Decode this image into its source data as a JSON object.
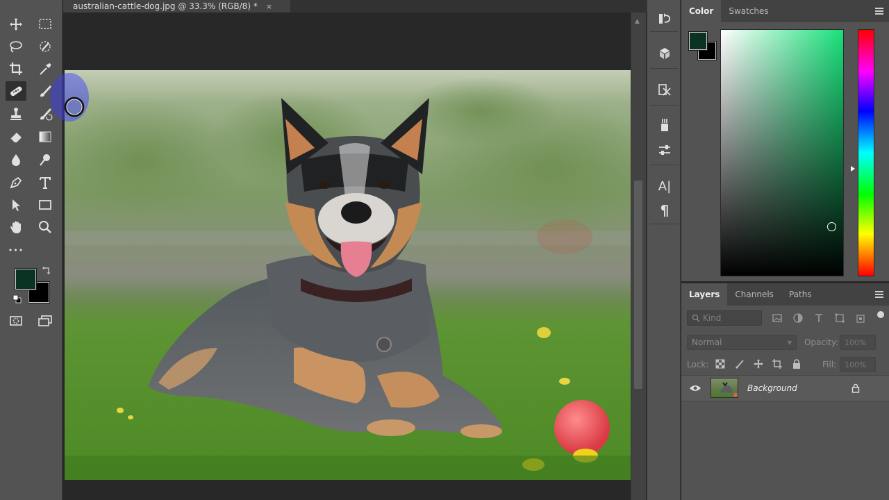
{
  "document": {
    "tab_title": "australian-cattle-dog.jpg @ 33.3% (RGB/8) *",
    "close_glyph": "×",
    "image_subject": "australian-cattle-dog-photo"
  },
  "toolbar": {
    "tools": [
      {
        "name": "move-tool-icon"
      },
      {
        "name": "rectangular-marquee-tool-icon"
      },
      {
        "name": "lasso-tool-icon"
      },
      {
        "name": "quick-selection-tool-icon"
      },
      {
        "name": "crop-tool-icon"
      },
      {
        "name": "eyedropper-tool-icon"
      },
      {
        "name": "spot-healing-brush-tool-icon",
        "active": true
      },
      {
        "name": "brush-tool-icon"
      },
      {
        "name": "clone-stamp-tool-icon"
      },
      {
        "name": "history-brush-tool-icon"
      },
      {
        "name": "eraser-tool-icon"
      },
      {
        "name": "gradient-tool-icon"
      },
      {
        "name": "blur-tool-icon"
      },
      {
        "name": "dodge-tool-icon"
      },
      {
        "name": "pen-tool-icon"
      },
      {
        "name": "type-tool-icon"
      },
      {
        "name": "path-selection-tool-icon"
      },
      {
        "name": "rectangle-tool-icon"
      },
      {
        "name": "hand-tool-icon"
      },
      {
        "name": "zoom-tool-icon"
      },
      {
        "name": "edit-toolbar-icon"
      }
    ],
    "more_glyph": "•••",
    "foreground_color": "#0a3323",
    "background_color": "#000000"
  },
  "color_panel": {
    "tabs": [
      "Color",
      "Swatches"
    ],
    "active_tab": "Color",
    "foreground_color": "#0a3323",
    "background_color": "#000000",
    "hue_color": "#19e07a"
  },
  "layers_panel": {
    "tabs": [
      "Layers",
      "Channels",
      "Paths"
    ],
    "active_tab": "Layers",
    "filter_placeholder": "Kind",
    "blend_mode": "Normal",
    "opacity_label": "Opacity:",
    "opacity_value": "100%",
    "lock_label": "Lock:",
    "fill_label": "Fill:",
    "fill_value": "100%",
    "layers": [
      {
        "name": "Background",
        "visible": true,
        "locked": true
      }
    ]
  },
  "panel_strip": {
    "buttons": [
      "history-icon",
      "3d-icon",
      "properties-icon",
      "brush-settings-icon",
      "adjustments-icon",
      "character-icon",
      "paragraph-icon"
    ],
    "character_glyph": "A|",
    "paragraph_glyph": "¶"
  }
}
